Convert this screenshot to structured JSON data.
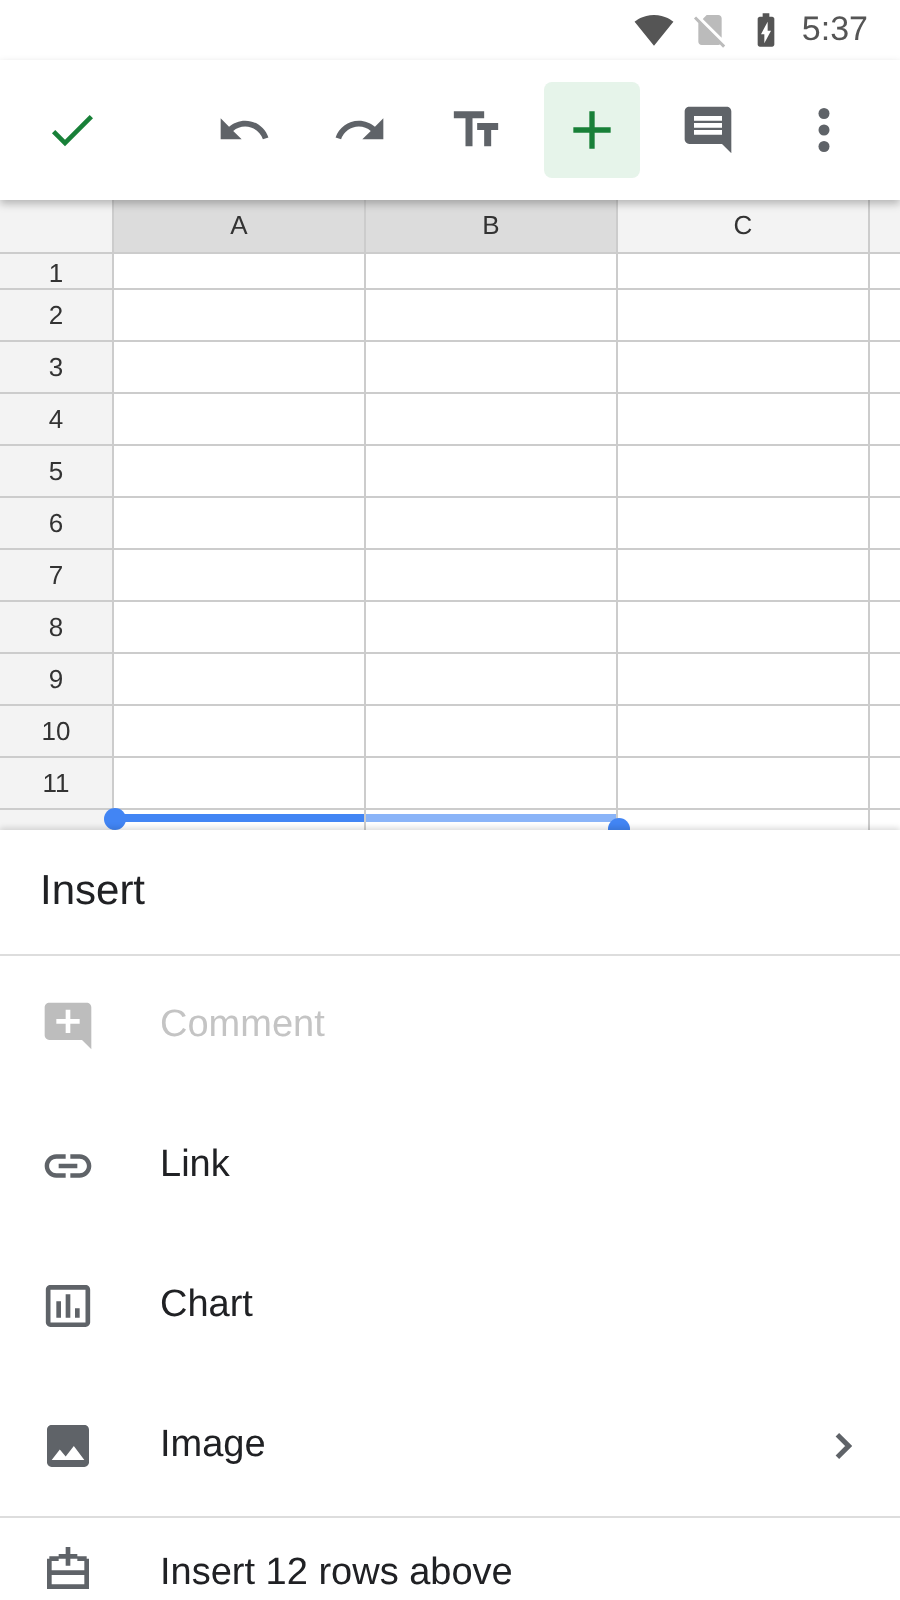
{
  "status_bar": {
    "time": "5:37"
  },
  "toolbar": {
    "insert_selected": true
  },
  "sheet": {
    "columns": [
      {
        "label": "A",
        "selected": true
      },
      {
        "label": "B",
        "selected": true
      },
      {
        "label": "C",
        "selected": false
      }
    ],
    "row_numbers": [
      "1",
      "2",
      "3",
      "4",
      "5",
      "6",
      "7",
      "8",
      "9",
      "10",
      "11"
    ]
  },
  "insert_menu": {
    "title": "Insert",
    "items": [
      {
        "kind": "comment",
        "label": "Comment",
        "disabled": true,
        "submenu": false
      },
      {
        "kind": "link",
        "label": "Link",
        "disabled": false,
        "submenu": false
      },
      {
        "kind": "chart",
        "label": "Chart",
        "disabled": false,
        "submenu": false
      },
      {
        "kind": "image",
        "label": "Image",
        "disabled": false,
        "submenu": true
      }
    ],
    "row_items": [
      {
        "kind": "rows-above",
        "label": "Insert 12 rows above",
        "disabled": false
      }
    ]
  }
}
